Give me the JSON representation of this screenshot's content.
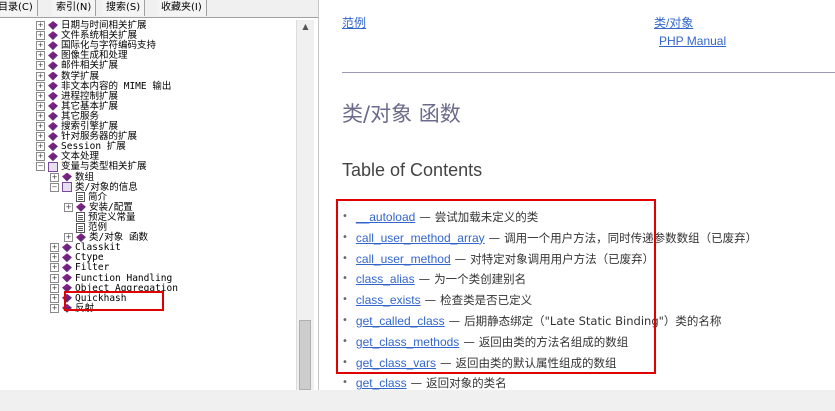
{
  "tabs": [
    "目录(C)",
    "索引(N)",
    "搜索(S)",
    "收藏夹(I)"
  ],
  "tree": [
    {
      "label": "日期与时间相关扩展",
      "pm": "⊞",
      "icon": "book",
      "indent": 0
    },
    {
      "label": "文件系统相关扩展",
      "pm": "⊞",
      "icon": "book",
      "indent": 0
    },
    {
      "label": "国际化与字符编码支持",
      "pm": "⊞",
      "icon": "book",
      "indent": 0
    },
    {
      "label": "图像生成和处理",
      "pm": "⊞",
      "icon": "book",
      "indent": 0
    },
    {
      "label": "邮件相关扩展",
      "pm": "⊞",
      "icon": "book",
      "indent": 0
    },
    {
      "label": "数学扩展",
      "pm": "⊞",
      "icon": "book",
      "indent": 0
    },
    {
      "label": "非文本内容的 MIME 输出",
      "pm": "⊞",
      "icon": "book",
      "indent": 0
    },
    {
      "label": "进程控制扩展",
      "pm": "⊞",
      "icon": "book",
      "indent": 0
    },
    {
      "label": "其它基本扩展",
      "pm": "⊞",
      "icon": "book",
      "indent": 0
    },
    {
      "label": "其它服务",
      "pm": "⊞",
      "icon": "book",
      "indent": 0
    },
    {
      "label": "搜索引擎扩展",
      "pm": "⊞",
      "icon": "book",
      "indent": 0
    },
    {
      "label": "针对服务器的扩展",
      "pm": "⊞",
      "icon": "book",
      "indent": 0
    },
    {
      "label": "Session 扩展",
      "pm": "⊞",
      "icon": "book",
      "indent": 0
    },
    {
      "label": "文本处理",
      "pm": "⊞",
      "icon": "book",
      "indent": 0
    },
    {
      "label": "变量与类型相关扩展",
      "pm": "⊟",
      "icon": "open",
      "indent": 0
    },
    {
      "label": "数组",
      "pm": "⊞",
      "icon": "book",
      "indent": 1
    },
    {
      "label": "类/对象的信息",
      "pm": "⊟",
      "icon": "open",
      "indent": 1
    },
    {
      "label": "简介",
      "pm": "",
      "icon": "page",
      "indent": 2
    },
    {
      "label": "安装/配置",
      "pm": "⊞",
      "icon": "book",
      "indent": 2
    },
    {
      "label": "预定义常量",
      "pm": "",
      "icon": "page",
      "indent": 2
    },
    {
      "label": "范例",
      "pm": "",
      "icon": "page",
      "indent": 2
    },
    {
      "label": "类/对象 函数",
      "pm": "⊞",
      "icon": "book",
      "indent": 2
    },
    {
      "label": "Classkit",
      "pm": "⊞",
      "icon": "book",
      "indent": 1
    },
    {
      "label": "Ctype",
      "pm": "⊞",
      "icon": "book",
      "indent": 1
    },
    {
      "label": "Filter",
      "pm": "⊞",
      "icon": "book",
      "indent": 1
    },
    {
      "label": "Function Handling",
      "pm": "⊞",
      "icon": "book",
      "indent": 1
    },
    {
      "label": "Object Aggregation",
      "pm": "⊞",
      "icon": "book",
      "indent": 1
    },
    {
      "label": "Quickhash",
      "pm": "⊞",
      "icon": "book",
      "indent": 1
    },
    {
      "label": "反射",
      "pm": "⊞",
      "icon": "book",
      "indent": 1
    }
  ],
  "right": {
    "nav_prev": "范例",
    "nav_up": "类/对象",
    "nav_manual": "PHP Manual",
    "title": "类/对象 函数",
    "toc_heading": "Table of Contents",
    "toc": [
      {
        "name": "__autoload",
        "desc": "尝试加载未定义的类"
      },
      {
        "name": "call_user_method_array",
        "desc": "调用一个用户方法，同时传递参数数组（已废弃）"
      },
      {
        "name": "call_user_method",
        "desc": "对特定对象调用用户方法（已废弃）"
      },
      {
        "name": "class_alias",
        "desc": "为一个类创建别名"
      },
      {
        "name": "class_exists",
        "desc": "检查类是否已定义"
      },
      {
        "name": "get_called_class",
        "desc": "后期静态绑定（\"Late Static Binding\"）类的名称"
      },
      {
        "name": "get_class_methods",
        "desc": "返回由类的方法名组成的数组"
      },
      {
        "name": "get_class_vars",
        "desc": "返回由类的默认属性组成的数组"
      },
      {
        "name": "get_class",
        "desc": "返回对象的类名"
      }
    ],
    "dash": "—"
  }
}
